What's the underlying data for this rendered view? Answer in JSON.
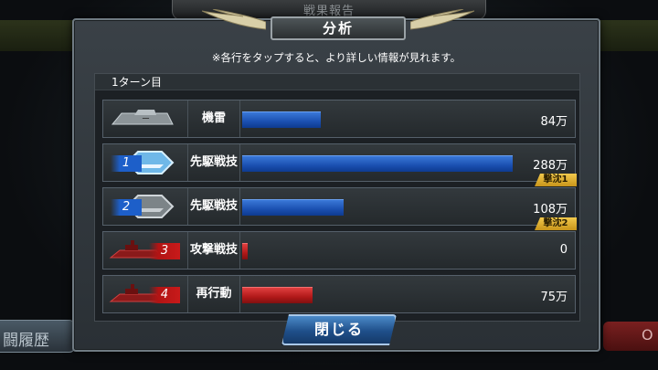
{
  "background": {
    "header_title": "戦果報告",
    "history_button": "闘履歴",
    "right_button": "O"
  },
  "dialog": {
    "title": "分析",
    "notice": "※各行をタップすると、より詳しい情報が見れます。",
    "turn_label": "1ターン目",
    "close_label": "閉じる"
  },
  "rows": [
    {
      "label": "機雷",
      "value": "84万",
      "amount": 84,
      "bar_color": "blue",
      "chip": "",
      "chip_color": "",
      "badge": "",
      "icon": "mine-ship-icon"
    },
    {
      "label": "先駆戦技",
      "value": "288万",
      "amount": 288,
      "bar_color": "blue",
      "chip": "1",
      "chip_color": "blue",
      "badge": "撃沈1",
      "icon": "blue-ship-icon"
    },
    {
      "label": "先駆戦技",
      "value": "108万",
      "amount": 108,
      "bar_color": "blue",
      "chip": "2",
      "chip_color": "blue",
      "badge": "撃沈2",
      "icon": "grey-ship-icon"
    },
    {
      "label": "攻撃戦技",
      "value": "0",
      "amount": 0,
      "bar_color": "red",
      "chip": "3",
      "chip_color": "red",
      "badge": "",
      "icon": "red-ship-icon"
    },
    {
      "label": "再行動",
      "value": "75万",
      "amount": 75,
      "bar_color": "red",
      "chip": "4",
      "chip_color": "red",
      "badge": "",
      "icon": "red-ship-icon"
    }
  ],
  "colors": {
    "blue_bar": "#1a4fb0",
    "red_bar": "#b01818",
    "badge": "#f2c94c",
    "button": "#1f4f8a"
  }
}
